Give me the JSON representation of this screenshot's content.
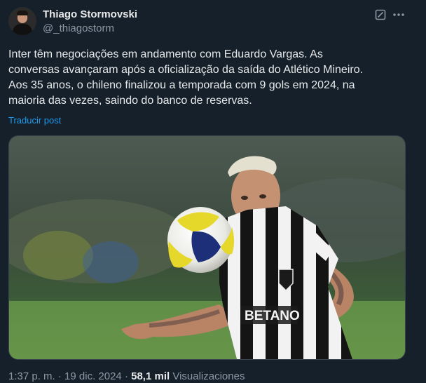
{
  "author": {
    "display_name": "Thiago Stormovski",
    "handle": "@_thiagostorm"
  },
  "icons": {
    "grok": "grok-icon",
    "more": "more-horizontal-icon"
  },
  "post": {
    "lines": [
      "Inter têm negociações em andamento com Eduardo Vargas. As",
      "conversas avançaram após a oficialização da saída do Atlético Mineiro.",
      "Aos 35 anos, o chileno finalizou a temporada com 9 gols em 2024, na",
      "maioria das vezes, saindo do banco de reservas."
    ],
    "translate_label": "Traducir post"
  },
  "media": {
    "shirt_sponsor": "BETANO"
  },
  "meta": {
    "time": "1:37 p. m.",
    "separator": "·",
    "date": "19 dic. 2024",
    "views_count": "58,1 mil",
    "views_label": "Visualizaciones"
  },
  "colors": {
    "background": "#15202b",
    "text": "#e7e9ea",
    "secondary_text": "#8b98a5",
    "link": "#1d9bf0"
  }
}
